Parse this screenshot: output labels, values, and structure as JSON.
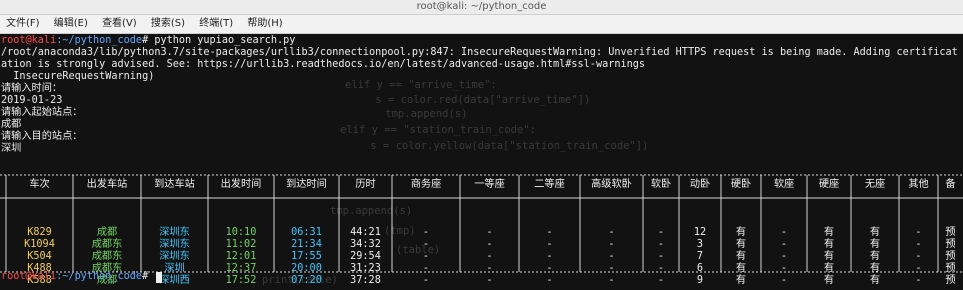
{
  "window": {
    "title": "root@kali: ~/python_code",
    "menu": [
      "文件(F)",
      "编辑(E)",
      "查看(V)",
      "搜索(S)",
      "终端(T)",
      "帮助(H)"
    ]
  },
  "terminal": {
    "prompt": {
      "user_host": "root@kali",
      "path": ":~/python_code",
      "symbol": "#",
      "command": " python yupiao_search.py"
    },
    "warning_lines": [
      "/root/anaconda3/lib/python3.7/site-packages/urllib3/connectionpool.py:847: InsecureRequestWarning: Unverified HTTPS request is being made. Adding certificat",
      "ation is strongly advised. See: https://urllib3.readthedocs.io/en/latest/advanced-usage.html#ssl-warnings",
      "  InsecureRequestWarning)"
    ],
    "prompts": [
      "请输入时间：",
      "2019-01-23",
      "请输入起始站点：",
      "成都",
      "请输入目的站点：",
      "深圳"
    ],
    "faded_source_lines": [
      "elif y == \"arrive_time\":",
      "    s = color.red(data[\"arrive_time\"])",
      "    tmp.append(s)",
      "elif y == \"station_train_code\":",
      "    s = color.yellow(data[\"station_train_code\"])"
    ],
    "faded_source_tail": [
      "tmp.append(s)",
      "(tmp)",
      "(table)",
      "print(table)"
    ],
    "final_prompt": {
      "user_host": "root@kali",
      "path": ":~/python_code",
      "symbol": "#"
    }
  },
  "table": {
    "headers": [
      "车次",
      "出发车站",
      "到达车站",
      "出发时间",
      "到达时间",
      "历时",
      "商务座",
      "一等座",
      "二等座",
      "高级软卧",
      "软卧",
      "动卧",
      "硬卧",
      "软座",
      "硬座",
      "无座",
      "其他",
      "备"
    ],
    "rows": [
      [
        "K829",
        "成都",
        "深圳东",
        "10:10",
        "06:31",
        "44:21",
        "-",
        "-",
        "-",
        "-",
        "-",
        "12",
        "有",
        "-",
        "有",
        "有",
        "-",
        "预"
      ],
      [
        "K1094",
        "成都东",
        "深圳东",
        "11:02",
        "21:34",
        "34:32",
        "-",
        "-",
        "-",
        "-",
        "-",
        "3",
        "有",
        "-",
        "有",
        "有",
        "-",
        "预"
      ],
      [
        "K504",
        "成都东",
        "深圳东",
        "12:01",
        "17:55",
        "29:54",
        "-",
        "-",
        "-",
        "-",
        "-",
        "7",
        "有",
        "-",
        "有",
        "有",
        "-",
        "预"
      ],
      [
        "K488",
        "成都东",
        "深圳",
        "12:37",
        "20:00",
        "31:23",
        "-",
        "-",
        "-",
        "-",
        "-",
        "6",
        "有",
        "-",
        "有",
        "有",
        "-",
        "预"
      ],
      [
        "K588",
        "成都",
        "深圳西",
        "17:52",
        "07:20",
        "37:28",
        "-",
        "-",
        "-",
        "-",
        "-",
        "9",
        "有",
        "-",
        "有",
        "有",
        "-",
        "预"
      ]
    ],
    "column_colors": [
      "yellow",
      "green",
      "cyan",
      "green",
      "cyan",
      "white",
      "white",
      "white",
      "white",
      "white",
      "white",
      "white",
      "white",
      "white",
      "white",
      "white",
      "white",
      "white"
    ],
    "colors": {
      "yellow": "#f1d046",
      "green": "#70d85f",
      "cyan": "#3bc9ff",
      "white": "#f0f0f0",
      "prompt_red": "#ff4b4b",
      "prompt_blue": "#5ea8ff"
    }
  }
}
